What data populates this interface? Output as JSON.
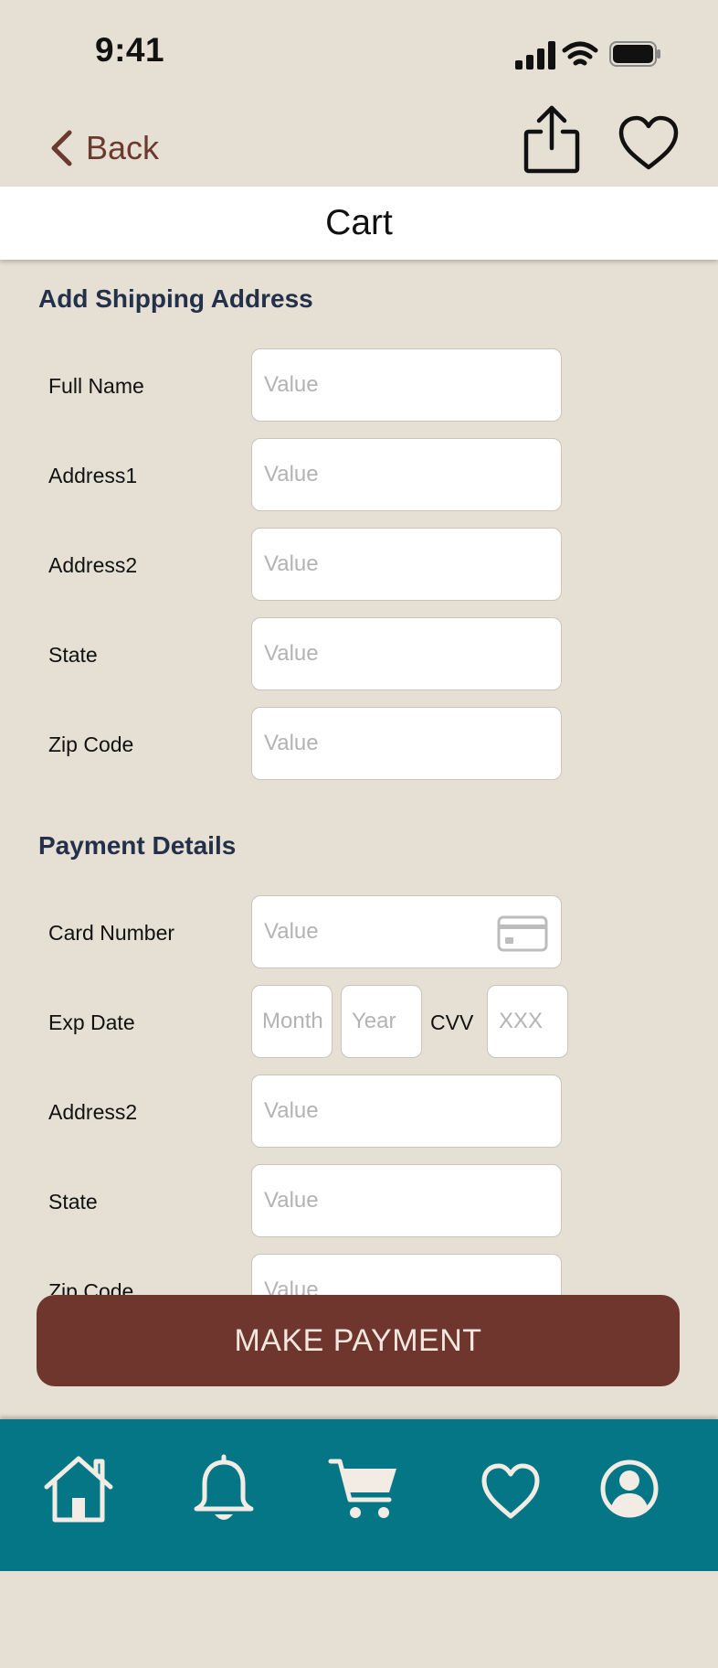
{
  "status_bar": {
    "time": "9:41"
  },
  "nav": {
    "back_label": "Back"
  },
  "header": {
    "title": "Cart"
  },
  "shipping": {
    "title": "Add Shipping Address",
    "fields": [
      {
        "label": "Full Name",
        "placeholder": "Value"
      },
      {
        "label": "Address1",
        "placeholder": "Value"
      },
      {
        "label": "Address2",
        "placeholder": "Value"
      },
      {
        "label": "State",
        "placeholder": "Value"
      },
      {
        "label": "Zip Code",
        "placeholder": "Value"
      }
    ]
  },
  "payment": {
    "title": "Payment Details",
    "card_number": {
      "label": "Card Number",
      "placeholder": "Value"
    },
    "exp_date": {
      "label": "Exp Date",
      "month_placeholder": "Month",
      "year_placeholder": "Year",
      "cvv_label": "CVV",
      "cvv_placeholder": "XXX"
    },
    "fields": [
      {
        "label": "Address2",
        "placeholder": "Value"
      },
      {
        "label": "State",
        "placeholder": "Value"
      },
      {
        "label": "Zip Code",
        "placeholder": "Value"
      }
    ]
  },
  "actions": {
    "make_payment": "MAKE PAYMENT"
  },
  "tab_bar": {
    "items": [
      {
        "icon": "home-icon"
      },
      {
        "icon": "bell-icon"
      },
      {
        "icon": "cart-icon"
      },
      {
        "icon": "heart-icon"
      },
      {
        "icon": "profile-icon"
      }
    ]
  },
  "colors": {
    "background": "#E6DFD3",
    "accent_brown": "#6E362C",
    "tab_bar": "#047686",
    "section_title": "#23304A"
  }
}
